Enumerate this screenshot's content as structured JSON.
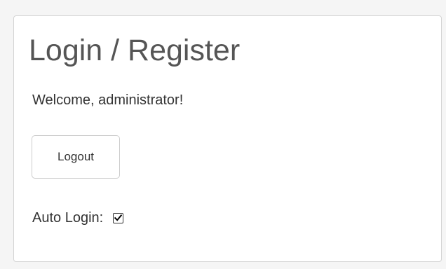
{
  "panel": {
    "title": "Login / Register",
    "welcome_text": "Welcome, administrator!",
    "logout_label": "Logout",
    "auto_login": {
      "label": "Auto Login:",
      "checked": true,
      "check_icon": "checkmark-icon"
    }
  },
  "colors": {
    "background": "#f5f5f5",
    "panel_background": "#ffffff",
    "panel_border": "#d4d4d4",
    "title_text": "#555555",
    "body_text": "#333333"
  }
}
